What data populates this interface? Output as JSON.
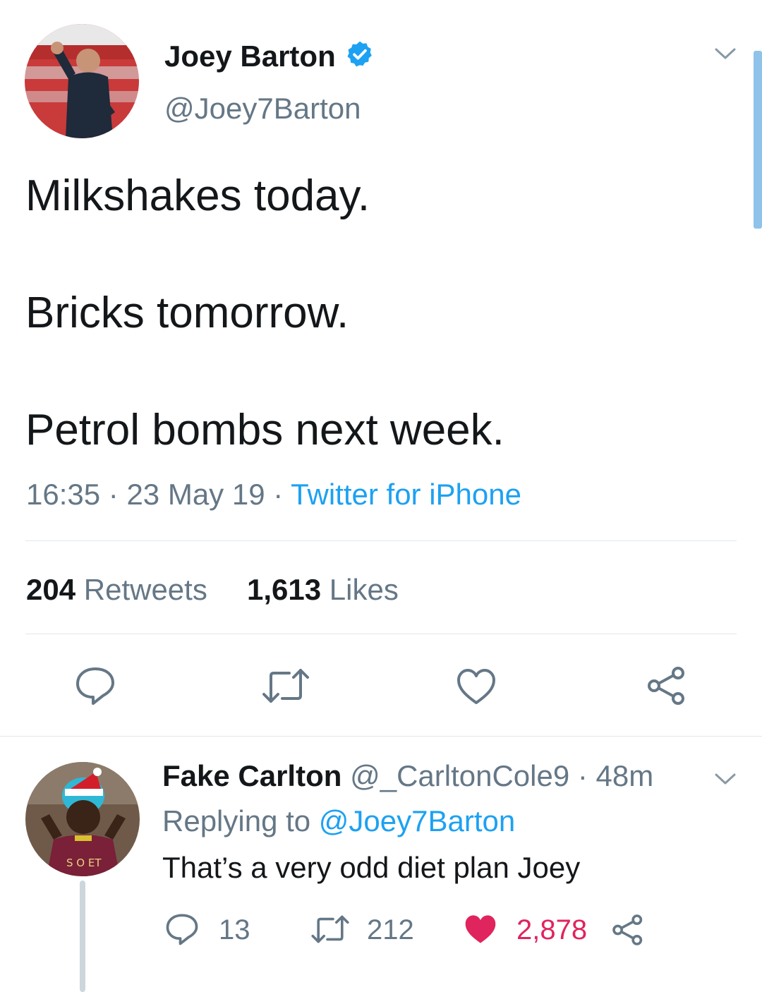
{
  "main_tweet": {
    "author_name": "Joey Barton",
    "author_handle": "@Joey7Barton",
    "lines": [
      "Milkshakes today.",
      "Bricks tomorrow.",
      "Petrol bombs next week."
    ],
    "time": "16:35",
    "date": "23 May 19",
    "source": "Twitter for iPhone",
    "separator": "·",
    "retweets_count": "204",
    "retweets_label": "Retweets",
    "likes_count": "1,613",
    "likes_label": "Likes"
  },
  "reply": {
    "author_name": "Fake Carlton",
    "author_handle": "@_CarltonCole9",
    "separator": "·",
    "age": "48m",
    "replying_prefix": "Replying to",
    "replying_to": "@Joey7Barton",
    "text": "That’s a very odd diet plan Joey",
    "reply_count": "13",
    "retweet_count": "212",
    "like_count": "2,878",
    "jersey_text": "S   O   ET"
  },
  "colors": {
    "accent": "#1da1f2",
    "muted": "#657786",
    "like": "#e0245e",
    "verified": "#1da1f2"
  },
  "icons": {
    "verified": "verified-badge-icon",
    "reply": "reply-icon",
    "retweet": "retweet-icon",
    "like": "heart-icon",
    "share": "share-icon",
    "menu": "chevron-down-icon"
  }
}
